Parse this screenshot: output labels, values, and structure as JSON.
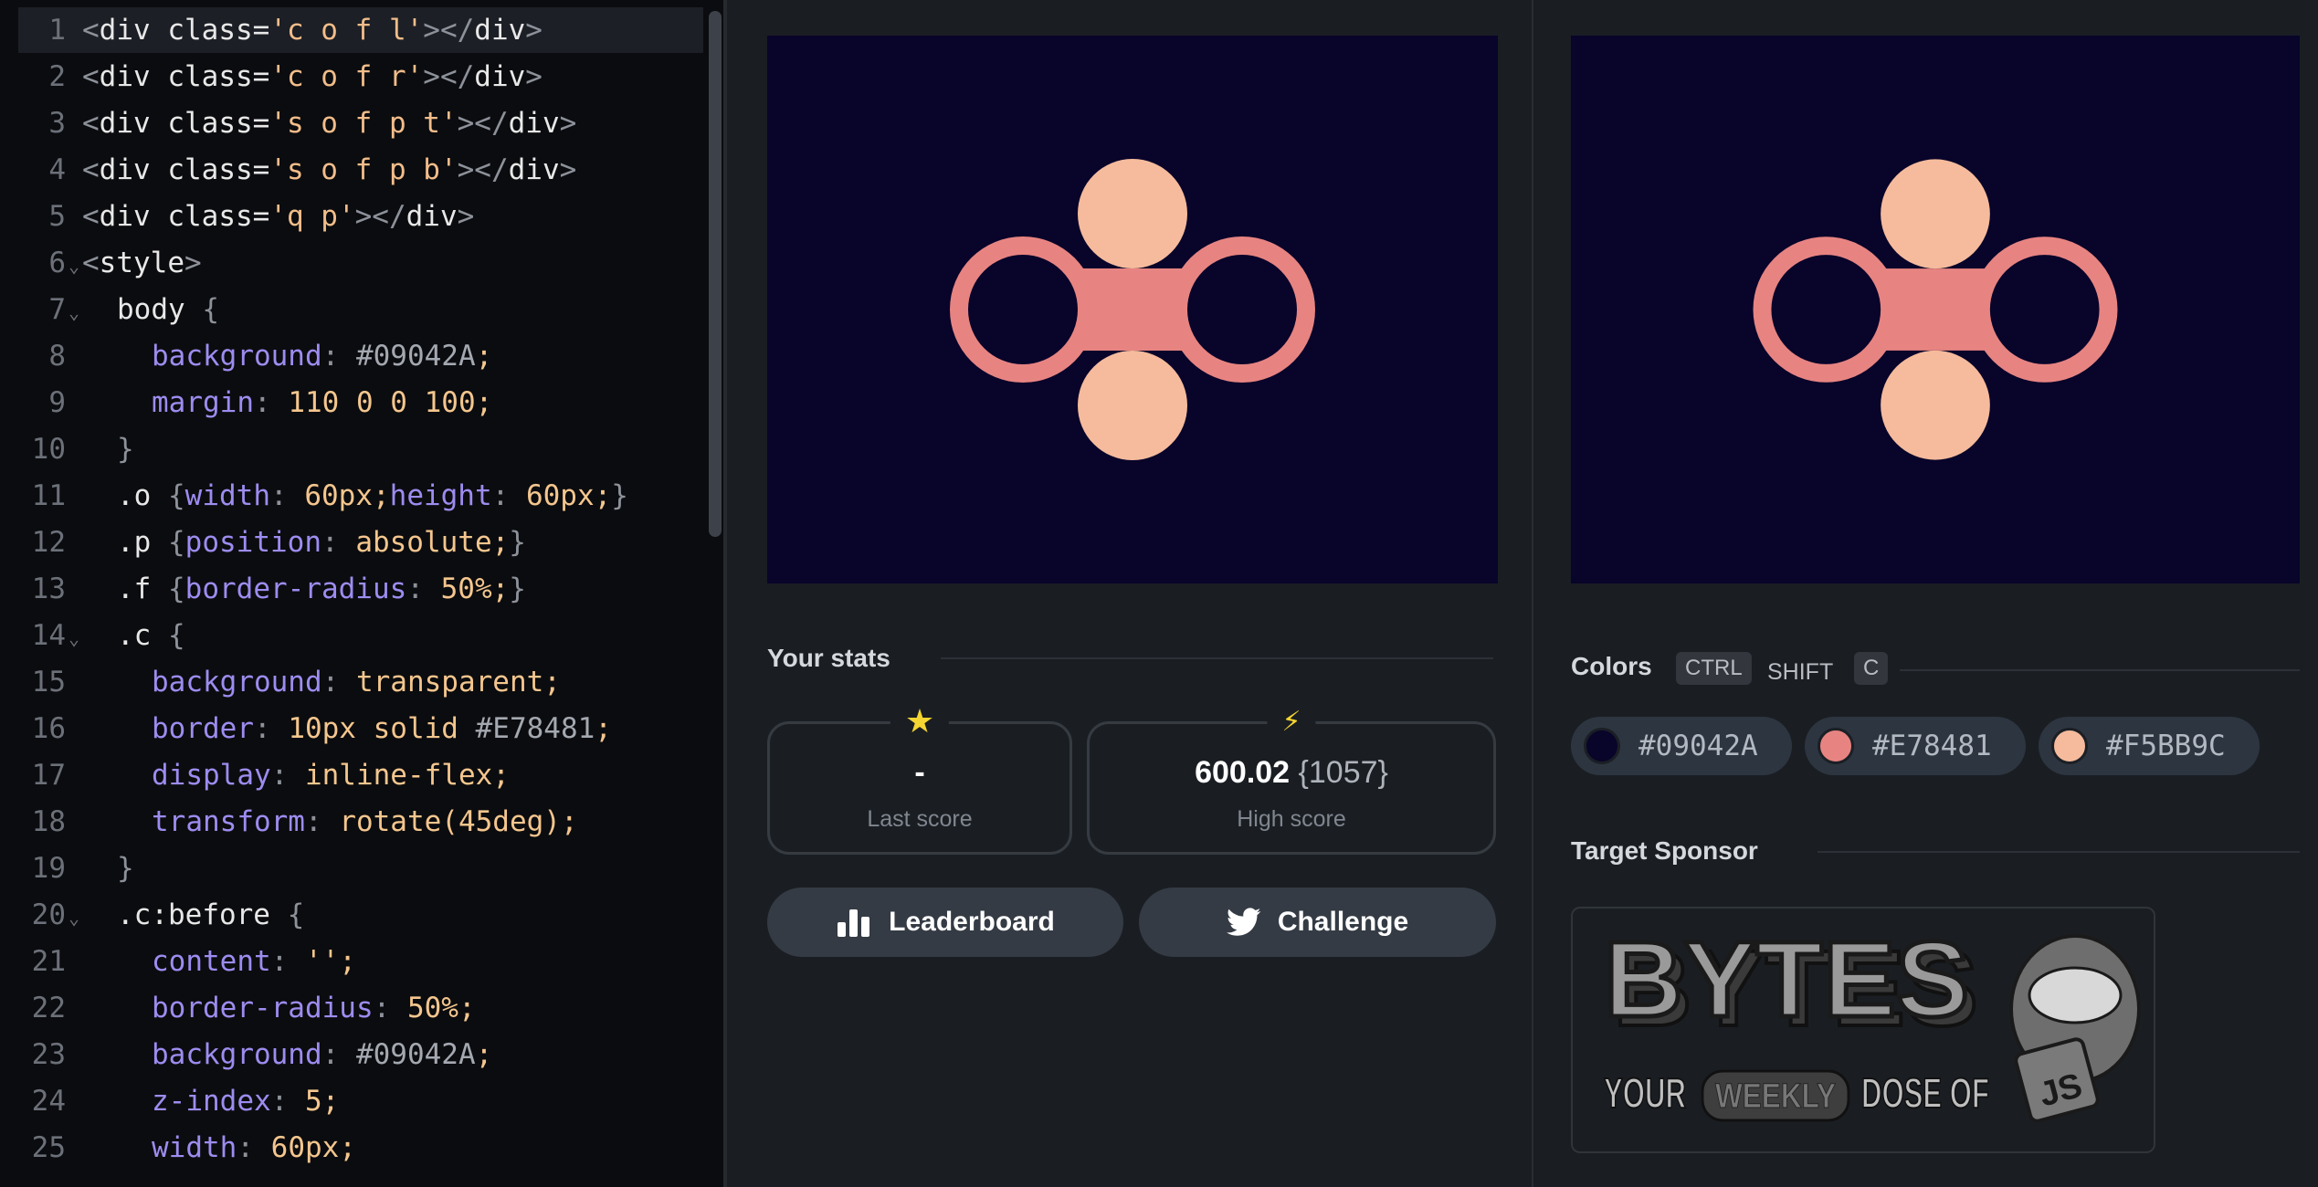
{
  "editor": {
    "lines": [
      {
        "n": "1",
        "fold": false,
        "indent": 0,
        "tokens": [
          [
            "t-punct",
            "<"
          ],
          [
            "t-tag",
            "div "
          ],
          [
            "t-tag",
            "class="
          ],
          [
            "t-str",
            "'c o f l'"
          ],
          [
            "t-punct",
            "></"
          ],
          [
            "t-tag",
            "div"
          ],
          [
            "t-punct",
            ">"
          ]
        ]
      },
      {
        "n": "2",
        "fold": false,
        "indent": 0,
        "tokens": [
          [
            "t-punct",
            "<"
          ],
          [
            "t-tag",
            "div "
          ],
          [
            "t-tag",
            "class="
          ],
          [
            "t-str",
            "'c o f r'"
          ],
          [
            "t-punct",
            "></"
          ],
          [
            "t-tag",
            "div"
          ],
          [
            "t-punct",
            ">"
          ]
        ]
      },
      {
        "n": "3",
        "fold": false,
        "indent": 0,
        "tokens": [
          [
            "t-punct",
            "<"
          ],
          [
            "t-tag",
            "div "
          ],
          [
            "t-tag",
            "class="
          ],
          [
            "t-str",
            "'s o f p t'"
          ],
          [
            "t-punct",
            "></"
          ],
          [
            "t-tag",
            "div"
          ],
          [
            "t-punct",
            ">"
          ]
        ]
      },
      {
        "n": "4",
        "fold": false,
        "indent": 0,
        "tokens": [
          [
            "t-punct",
            "<"
          ],
          [
            "t-tag",
            "div "
          ],
          [
            "t-tag",
            "class="
          ],
          [
            "t-str",
            "'s o f p b'"
          ],
          [
            "t-punct",
            "></"
          ],
          [
            "t-tag",
            "div"
          ],
          [
            "t-punct",
            ">"
          ]
        ]
      },
      {
        "n": "5",
        "fold": false,
        "indent": 0,
        "tokens": [
          [
            "t-punct",
            "<"
          ],
          [
            "t-tag",
            "div "
          ],
          [
            "t-tag",
            "class="
          ],
          [
            "t-str",
            "'q p'"
          ],
          [
            "t-punct",
            "></"
          ],
          [
            "t-tag",
            "div"
          ],
          [
            "t-punct",
            ">"
          ]
        ]
      },
      {
        "n": "6",
        "fold": true,
        "indent": 0,
        "tokens": [
          [
            "t-punct",
            "<"
          ],
          [
            "t-tag",
            "style"
          ],
          [
            "t-punct",
            ">"
          ]
        ]
      },
      {
        "n": "7",
        "fold": true,
        "indent": 1,
        "tokens": [
          [
            "t-sel",
            "body "
          ],
          [
            "t-punct",
            "{"
          ]
        ]
      },
      {
        "n": "8",
        "fold": false,
        "indent": 2,
        "tokens": [
          [
            "t-prop",
            "background"
          ],
          [
            "t-punct",
            ": "
          ],
          [
            "t-hex",
            "#09042A"
          ],
          [
            "t-val",
            ";"
          ]
        ]
      },
      {
        "n": "9",
        "fold": false,
        "indent": 2,
        "tokens": [
          [
            "t-prop",
            "margin"
          ],
          [
            "t-punct",
            ": "
          ],
          [
            "t-val",
            "110 0 0 100;"
          ]
        ]
      },
      {
        "n": "10",
        "fold": false,
        "indent": 1,
        "tokens": [
          [
            "t-punct",
            "}"
          ]
        ]
      },
      {
        "n": "11",
        "fold": false,
        "indent": 1,
        "tokens": [
          [
            "t-sel",
            ".o "
          ],
          [
            "t-punct",
            "{"
          ],
          [
            "t-prop",
            "width"
          ],
          [
            "t-punct",
            ": "
          ],
          [
            "t-val",
            "60px;"
          ],
          [
            "t-prop",
            "height"
          ],
          [
            "t-punct",
            ": "
          ],
          [
            "t-val",
            "60px;"
          ],
          [
            "t-punct",
            "}"
          ]
        ]
      },
      {
        "n": "12",
        "fold": false,
        "indent": 1,
        "tokens": [
          [
            "t-sel",
            ".p "
          ],
          [
            "t-punct",
            "{"
          ],
          [
            "t-prop",
            "position"
          ],
          [
            "t-punct",
            ": "
          ],
          [
            "t-val",
            "absolute;"
          ],
          [
            "t-punct",
            "}"
          ]
        ]
      },
      {
        "n": "13",
        "fold": false,
        "indent": 1,
        "tokens": [
          [
            "t-sel",
            ".f "
          ],
          [
            "t-punct",
            "{"
          ],
          [
            "t-prop",
            "border-radius"
          ],
          [
            "t-punct",
            ": "
          ],
          [
            "t-val",
            "50%;"
          ],
          [
            "t-punct",
            "}"
          ]
        ]
      },
      {
        "n": "14",
        "fold": true,
        "indent": 1,
        "tokens": [
          [
            "t-sel",
            ".c "
          ],
          [
            "t-punct",
            "{"
          ]
        ]
      },
      {
        "n": "15",
        "fold": false,
        "indent": 2,
        "tokens": [
          [
            "t-prop",
            "background"
          ],
          [
            "t-punct",
            ": "
          ],
          [
            "t-val",
            "transparent;"
          ]
        ]
      },
      {
        "n": "16",
        "fold": false,
        "indent": 2,
        "tokens": [
          [
            "t-prop",
            "border"
          ],
          [
            "t-punct",
            ": "
          ],
          [
            "t-val",
            "10px solid "
          ],
          [
            "t-hex",
            "#E78481"
          ],
          [
            "t-val",
            ";"
          ]
        ]
      },
      {
        "n": "17",
        "fold": false,
        "indent": 2,
        "tokens": [
          [
            "t-prop",
            "display"
          ],
          [
            "t-punct",
            ": "
          ],
          [
            "t-val",
            "inline-flex;"
          ]
        ]
      },
      {
        "n": "18",
        "fold": false,
        "indent": 2,
        "tokens": [
          [
            "t-prop",
            "transform"
          ],
          [
            "t-punct",
            ": "
          ],
          [
            "t-val",
            "rotate(45deg);"
          ]
        ]
      },
      {
        "n": "19",
        "fold": false,
        "indent": 1,
        "tokens": [
          [
            "t-punct",
            "}"
          ]
        ]
      },
      {
        "n": "20",
        "fold": true,
        "indent": 1,
        "tokens": [
          [
            "t-sel",
            ".c:before "
          ],
          [
            "t-punct",
            "{"
          ]
        ]
      },
      {
        "n": "21",
        "fold": false,
        "indent": 2,
        "tokens": [
          [
            "t-prop",
            "content"
          ],
          [
            "t-punct",
            ": "
          ],
          [
            "t-val",
            "'';"
          ]
        ]
      },
      {
        "n": "22",
        "fold": false,
        "indent": 2,
        "tokens": [
          [
            "t-prop",
            "border-radius"
          ],
          [
            "t-punct",
            ": "
          ],
          [
            "t-val",
            "50%;"
          ]
        ]
      },
      {
        "n": "23",
        "fold": false,
        "indent": 2,
        "tokens": [
          [
            "t-prop",
            "background"
          ],
          [
            "t-punct",
            ": "
          ],
          [
            "t-hex",
            "#09042A"
          ],
          [
            "t-val",
            ";"
          ]
        ]
      },
      {
        "n": "24",
        "fold": false,
        "indent": 2,
        "tokens": [
          [
            "t-prop",
            "z-index"
          ],
          [
            "t-punct",
            ": "
          ],
          [
            "t-val",
            "5;"
          ]
        ]
      },
      {
        "n": "25",
        "fold": false,
        "indent": 2,
        "tokens": [
          [
            "t-prop",
            "width"
          ],
          [
            "t-punct",
            ": "
          ],
          [
            "t-val",
            "60px;"
          ]
        ]
      }
    ]
  },
  "stats": {
    "title": "Your stats",
    "last_score_value": "-",
    "last_score_label": "Last score",
    "high_score_value": "600.02",
    "high_score_sub": "{1057}",
    "high_score_label": "High score",
    "star_icon": "★",
    "bolt_icon": "⚡"
  },
  "buttons": {
    "leaderboard": "Leaderboard",
    "challenge": "Challenge"
  },
  "colors": {
    "title": "Colors",
    "shortcut_ctrl": "CTRL",
    "shortcut_shift": "SHIFT",
    "shortcut_c": "C",
    "palette": [
      {
        "hex": "#09042A",
        "label": "#09042A"
      },
      {
        "hex": "#E78481",
        "label": "#E78481"
      },
      {
        "hex": "#F5BB9C",
        "label": "#F5BB9C"
      }
    ]
  },
  "sponsor": {
    "title": "Target Sponsor",
    "name": "BYTES",
    "tagline_your": "YOUR",
    "tagline_weekly": "WEEKLY",
    "tagline_dose": "DOSE OF",
    "badge": "JS"
  },
  "canvas": {
    "bg": "#09042A",
    "ring_color": "#E78481",
    "dot_color": "#F5BB9C"
  }
}
